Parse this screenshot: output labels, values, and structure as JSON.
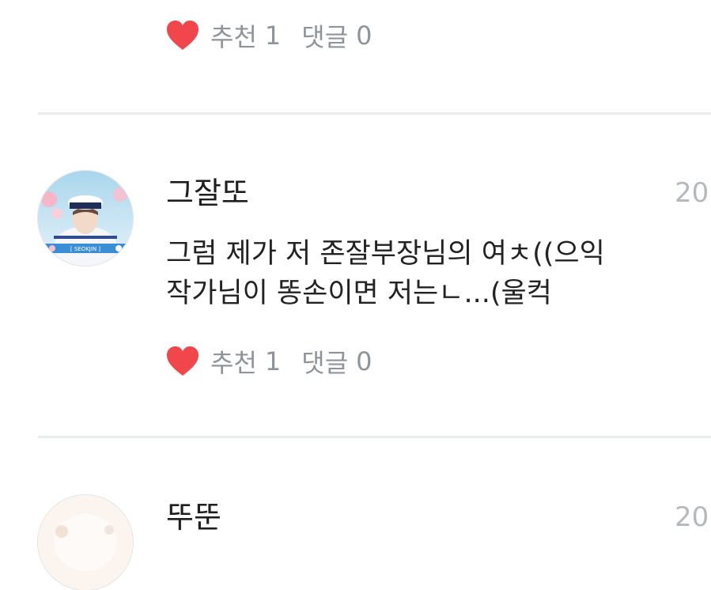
{
  "comments": [
    {
      "likes_label": "추천",
      "likes_count": "1",
      "replies_label": "댓글",
      "replies_count": "0"
    },
    {
      "username": "그잘또",
      "time": "20",
      "avatar_caption": "[ SEOKJIN ]",
      "text_lines": [
        "그럼 제가 저 존잘부장님의 여ㅊ((으익",
        "작가님이 똥손이면 저는ㄴ...(울컥"
      ],
      "likes_label": "추천",
      "likes_count": "1",
      "replies_label": "댓글",
      "replies_count": "0"
    },
    {
      "username": "뚜뚠",
      "time": "20"
    }
  ],
  "colors": {
    "heart": "#f0464c",
    "muted_text": "#8d959b",
    "divider": "#e7ecec",
    "timestamp": "#b3b9bd"
  }
}
